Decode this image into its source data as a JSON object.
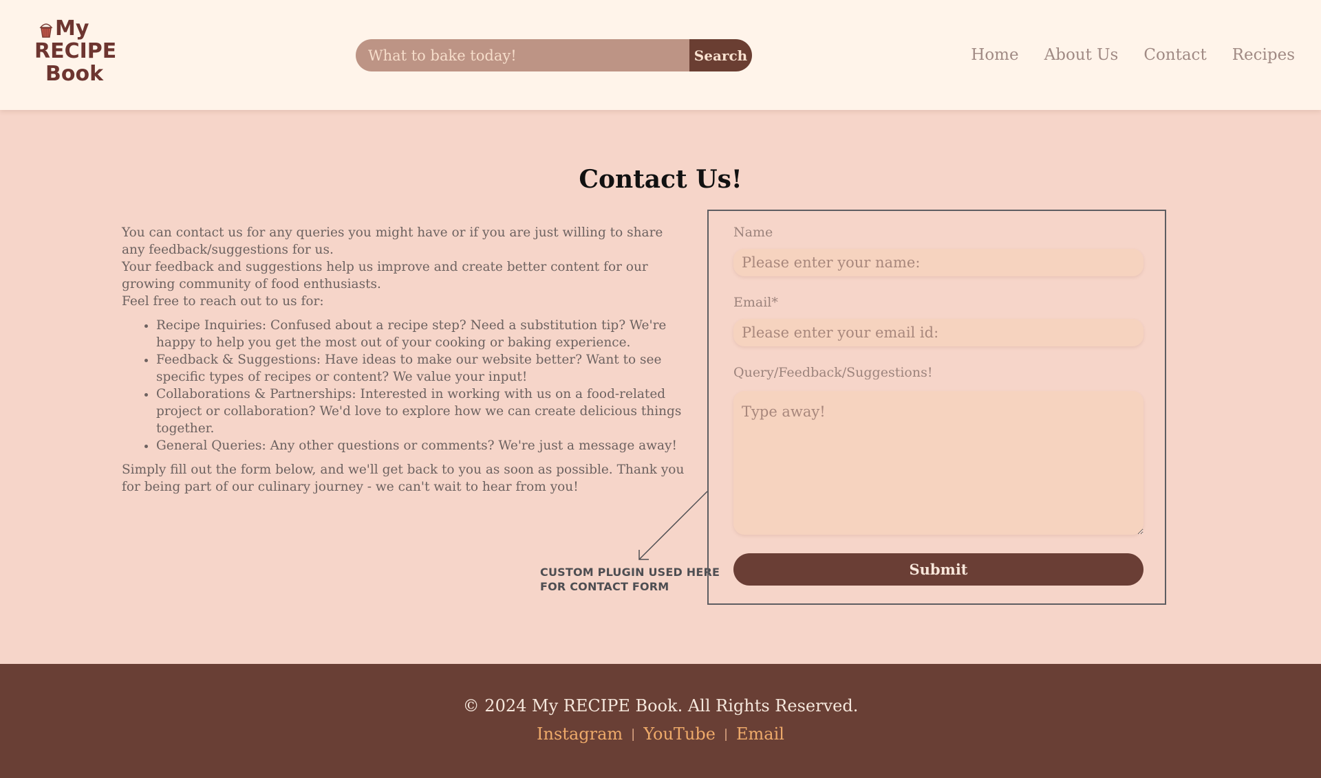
{
  "brand": {
    "logo_lines": [
      "My",
      "RECIPE",
      "Book"
    ]
  },
  "search": {
    "placeholder": "What to bake today!",
    "button_label": "Search"
  },
  "nav": {
    "items": [
      "Home",
      "About Us",
      "Contact",
      "Recipes"
    ]
  },
  "main": {
    "title": "Contact Us!",
    "intro": [
      "You can contact us for any queries you might have or if you are just willing to share any feedback/suggestions for us.",
      "Your feedback and suggestions help us improve and create better content for our growing community of food enthusiasts.",
      "Feel free to reach out to us for:"
    ],
    "bullets": [
      "Recipe Inquiries: Confused about a recipe step? Need a substitution tip? We're happy to help you get the most out of your cooking or baking experience.",
      "Feedback & Suggestions: Have ideas to make our website better? Want to see specific types of recipes or content? We value your input!",
      "Collaborations & Partnerships: Interested in working with us on a food-related project or collaboration? We'd love to explore how we can create delicious things together.",
      "General Queries: Any other questions or comments? We're just a message away!"
    ],
    "closing": "Simply fill out the form below, and we'll get back to you as soon as possible. Thank you for being part of our culinary journey - we can't wait to hear from you!",
    "annotation_lines": [
      "CUSTOM PLUGIN USED HERE",
      "FOR CONTACT FORM"
    ]
  },
  "form": {
    "name_label": "Name",
    "name_placeholder": "Please enter your name:",
    "email_label": "Email*",
    "email_placeholder": "Please enter your email id:",
    "query_label": "Query/Feedback/Suggestions!",
    "query_placeholder": "Type away!",
    "submit_label": "Submit"
  },
  "footer": {
    "copyright": "© 2024 My RECIPE Book. All Rights Reserved.",
    "links": [
      "Instagram",
      "YouTube",
      "Email"
    ],
    "separator": "|"
  },
  "colors": {
    "header_bg": "#fff4ea",
    "page_bg": "#f6d5c9",
    "footer_bg": "#693f35",
    "accent_brown": "#6a3e35",
    "footer_link": "#eeaa6a"
  }
}
